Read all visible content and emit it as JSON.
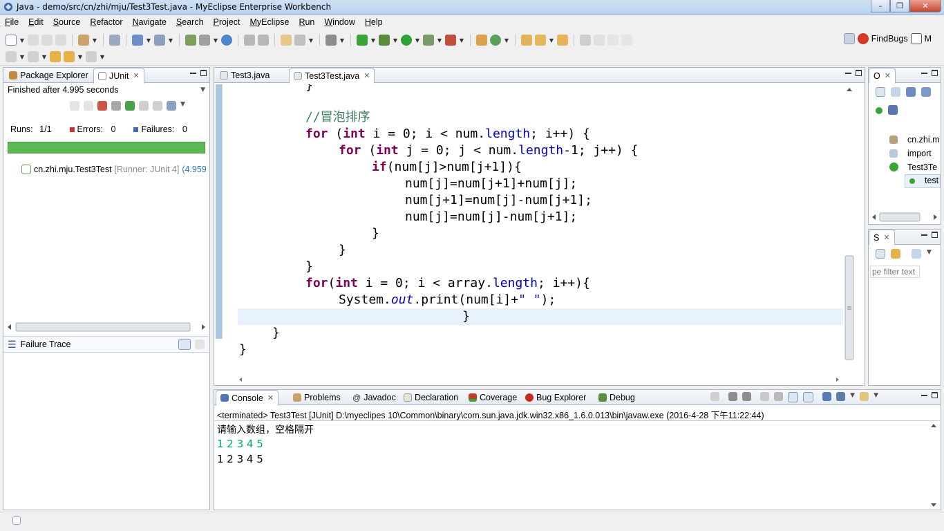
{
  "window": {
    "title": "Java - demo/src/cn/zhi/mju/Test3Test.java - MyEclipse Enterprise Workbench"
  },
  "menu": [
    "File",
    "Edit",
    "Source",
    "Refactor",
    "Navigate",
    "Search",
    "Project",
    "MyEclipse",
    "Run",
    "Window",
    "Help"
  ],
  "toolbar": {
    "findbugs_label": "FindBugs",
    "perspective_label": "M"
  },
  "left_panel": {
    "tabs": [
      {
        "label": "Package Explorer",
        "icon": "package-explorer-icon"
      },
      {
        "label": "JUnit",
        "icon": "junit-icon"
      }
    ],
    "status": "Finished after 4.995 seconds",
    "runs_label": "Runs:",
    "runs_value": "1/1",
    "errors_label": "Errors:",
    "errors_value": "0",
    "failures_label": "Failures:",
    "failures_value": "0",
    "bar_color": "#5eb854",
    "tree_item_name": "cn.zhi.mju.Test3Test",
    "tree_item_runner": "[Runner: JUnit 4]",
    "tree_item_time": "(4.959",
    "failure_trace_label": "Failure Trace"
  },
  "editor": {
    "tabs": [
      {
        "label": "Test3.java"
      },
      {
        "label": "Test3Test.java"
      }
    ]
  },
  "outline_panel": {
    "tab_label": "O",
    "items": [
      "cn.zhi.m",
      "import",
      "Test3Te",
      "test"
    ]
  },
  "tasks_panel": {
    "tab_label": "S",
    "filter_placeholder": "pe filter text"
  },
  "console_panel": {
    "tabs": [
      {
        "label": "Console"
      },
      {
        "label": "Problems"
      },
      {
        "label": "Javadoc"
      },
      {
        "label": "Declaration"
      },
      {
        "label": "Coverage"
      },
      {
        "label": "Bug Explorer"
      },
      {
        "label": "Debug"
      }
    ],
    "header": "<terminated> Test3Test [JUnit] D:\\myeclipes 10\\Common\\binary\\com.sun.java.jdk.win32.x86_1.6.0.013\\bin\\javaw.exe (2016-4-28 下午11:22:44)",
    "lines": [
      {
        "text": "请输入数组，空格隔开"
      },
      {
        "text": "1 2 3 4 5"
      },
      {
        "text": "1 2 3 4 5"
      }
    ]
  },
  "colors": {
    "keyword": "#7f0055",
    "field": "#0000c0",
    "comment": "#3f7f5f",
    "string": "#2a00ff",
    "console_input": "#00a47a",
    "junit_success": "#5eb854"
  }
}
